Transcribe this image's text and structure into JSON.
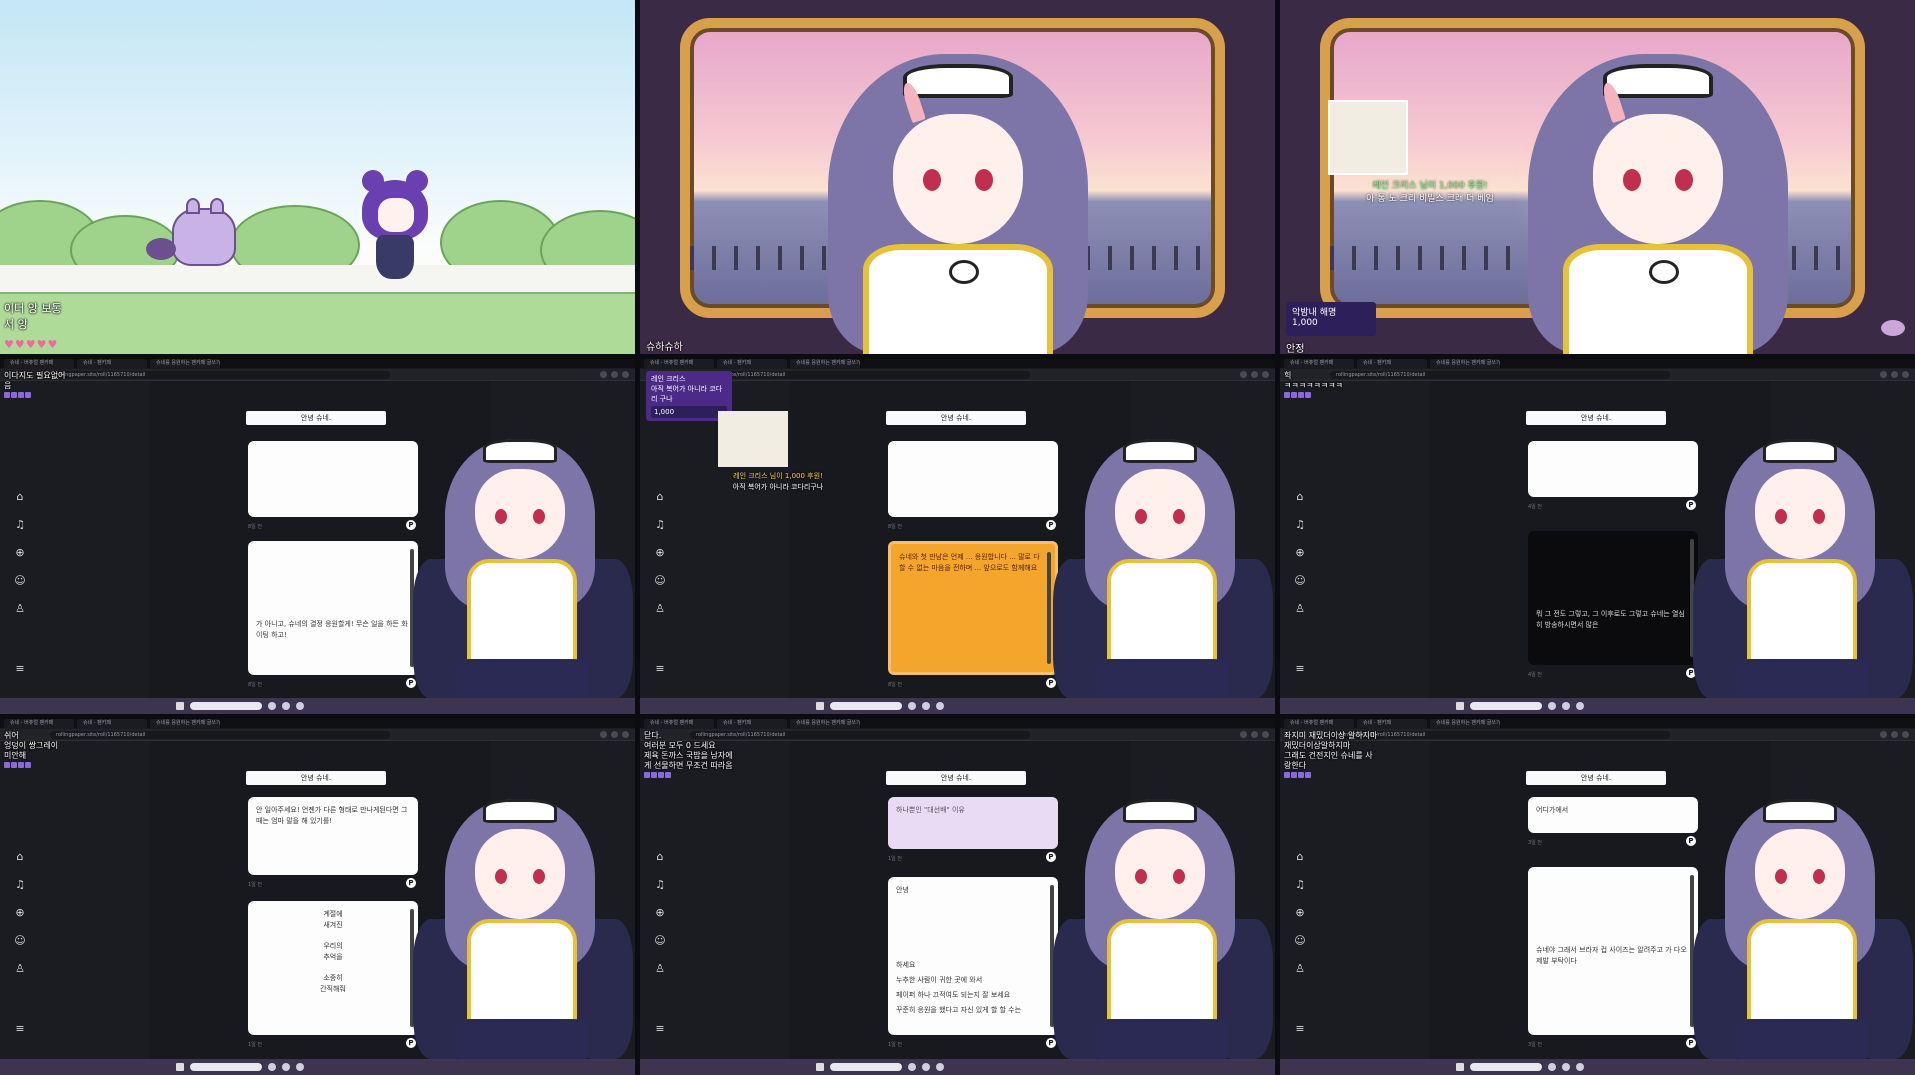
{
  "game": {
    "hud_line1": "이더 앙 보통",
    "hud_line2": "서 앙",
    "hud_hearts": "♥♥♥♥♥"
  },
  "stream_a": {
    "corner_text": "슈하슈하"
  },
  "stream_b": {
    "donation_line": "레인 크리스 님이 1,000 후원!",
    "donation_msg": "아 통 노 크리 비밀스 크래 더 베임",
    "supporter_name": "악밤내 해명",
    "supporter_amount": "1,000",
    "corner_text": "안정"
  },
  "browser": {
    "tabs": [
      "슈네 - 버츄얼 팬카페",
      "슈네 - 팬카페",
      "슈네를 응원하는 팬카페 글쓰기"
    ],
    "url": "rollingpaper.site/roll/1165710/detail",
    "taskbar_icons": 3
  },
  "screen1": {
    "chat": [
      "이다지도 필요없어",
      "음"
    ],
    "post_title": "안녕 슈네.",
    "card2_text": "가 아니고, 슈네의 결정 응원할게! 무슨 일을 하든 화이팅 하고!",
    "meta1": "8일 전",
    "meta2": "8일 전"
  },
  "screen2": {
    "alert_title": "레인 크리스",
    "alert_msg": "아직 복어가 아니라 코다리 구나",
    "alert_amount": "1,000",
    "donation_line": "레인 크리스 님이 1,000 후원!",
    "donation_msg": "아직 복어가 아니라 코다리구나",
    "post_title": "안녕 슈네.",
    "card2_text": "슈네와 첫 만남은 언제 ... 응원합니다 ... 말로 다 할 수 없는 마음을 전하며 ... 앞으로도 함께해요",
    "meta1": "8일 전",
    "meta2": "8일 전"
  },
  "screen3": {
    "chat": [
      "힉",
      "ㅋㅋㅋㅋㅋㅋㅋㅋ"
    ],
    "post_title": "안녕 슈네.",
    "card2_text": "뭐 그 전도 그렇고, 그 이후로도 그렇고 슈네는 열심히 방송하시면서 많은",
    "meta1": "4일 전",
    "meta2": "4일 전"
  },
  "screen4": {
    "chat": [
      "쉬어",
      "엉덩이 쌍그레이",
      "미안해"
    ],
    "post_title": "안녕 슈네.",
    "card1_text": "안 일아주세요! 언젠가 다른 형태로 만나게된다면 그때는 엄마 말을 해 있기를!",
    "card2_lines": [
      "계절에",
      "새겨진",
      "우리의",
      "추억을",
      "소중히",
      "간직해줘"
    ],
    "meta1": "1일 전",
    "meta2": "1일 전"
  },
  "screen5": {
    "chat": [
      "닫다.",
      "여러분 모두 0 드세요",
      "제육 돈까스 국밥을 남자에",
      "게 선물하면 무조건 따라옴"
    ],
    "post_title": "안녕 슈네.",
    "card1_text": "하나뿐인 \"대선배\" 이유",
    "card2_lines": [
      "안녕",
      "하세요",
      "누추한 사람이 귀한 곳에 와서",
      "페이퍼 하나 끄적여도 되는지 잘 보세요",
      "꾸준히 응원을 했다고 자신 있게 할 할 수는"
    ],
    "meta1": "1일 전",
    "meta2": "1일 전"
  },
  "screen6": {
    "chat": [
      "좌지미 재밌더이상 알하지마",
      "재밌더이상알하지마",
      "그래도 건전지인 슈네를 사",
      "랑한다"
    ],
    "post_title": "안녕 슈네.",
    "card1_text": "어디가에서",
    "card2_text": "슈네야 그래서 브라자 컵 사이즈는 알려주고 가 다오 제발 부탁이다",
    "meta1": "3일 전",
    "meta2": "3일 전"
  }
}
